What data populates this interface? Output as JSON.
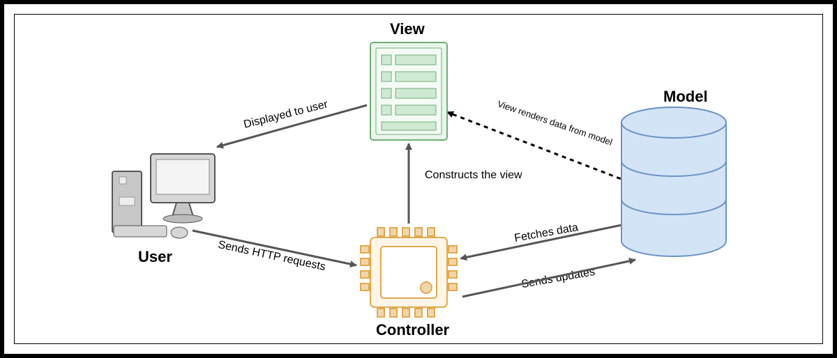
{
  "nodes": {
    "view": {
      "label": "View"
    },
    "model": {
      "label": "Model"
    },
    "user": {
      "label": "User"
    },
    "controller": {
      "label": "Controller"
    }
  },
  "edges": {
    "view_to_user": {
      "label": "Displayed to user"
    },
    "user_to_controller": {
      "label": "Sends HTTP requests"
    },
    "controller_to_view": {
      "label": "Constructs the view"
    },
    "controller_model_fetch": {
      "label": "Fetches data"
    },
    "controller_to_model": {
      "label": "Sends updates"
    },
    "model_to_view": {
      "label": "View renders data from model"
    }
  }
}
